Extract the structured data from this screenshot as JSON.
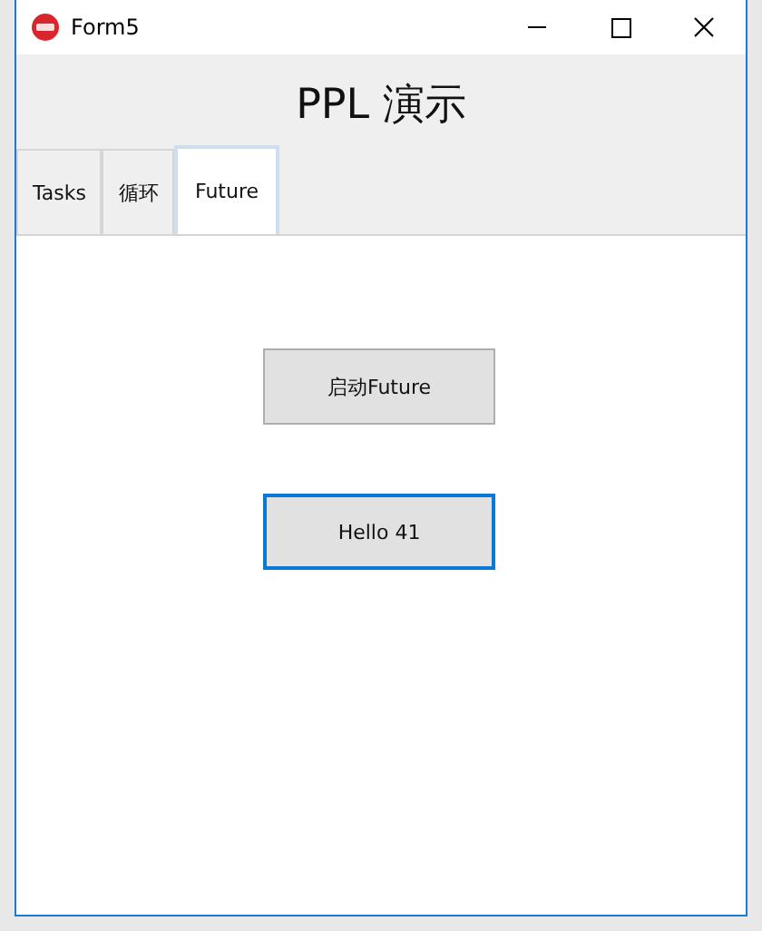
{
  "window": {
    "title": "Form5"
  },
  "header": {
    "title": "PPL 演示"
  },
  "tabs": [
    {
      "label": "Tasks",
      "selected": false
    },
    {
      "label": "循环",
      "selected": false
    },
    {
      "label": "Future",
      "selected": true
    }
  ],
  "buttons": [
    {
      "label": "启动Future",
      "focused": false
    },
    {
      "label": "Hello 41",
      "focused": true
    }
  ]
}
